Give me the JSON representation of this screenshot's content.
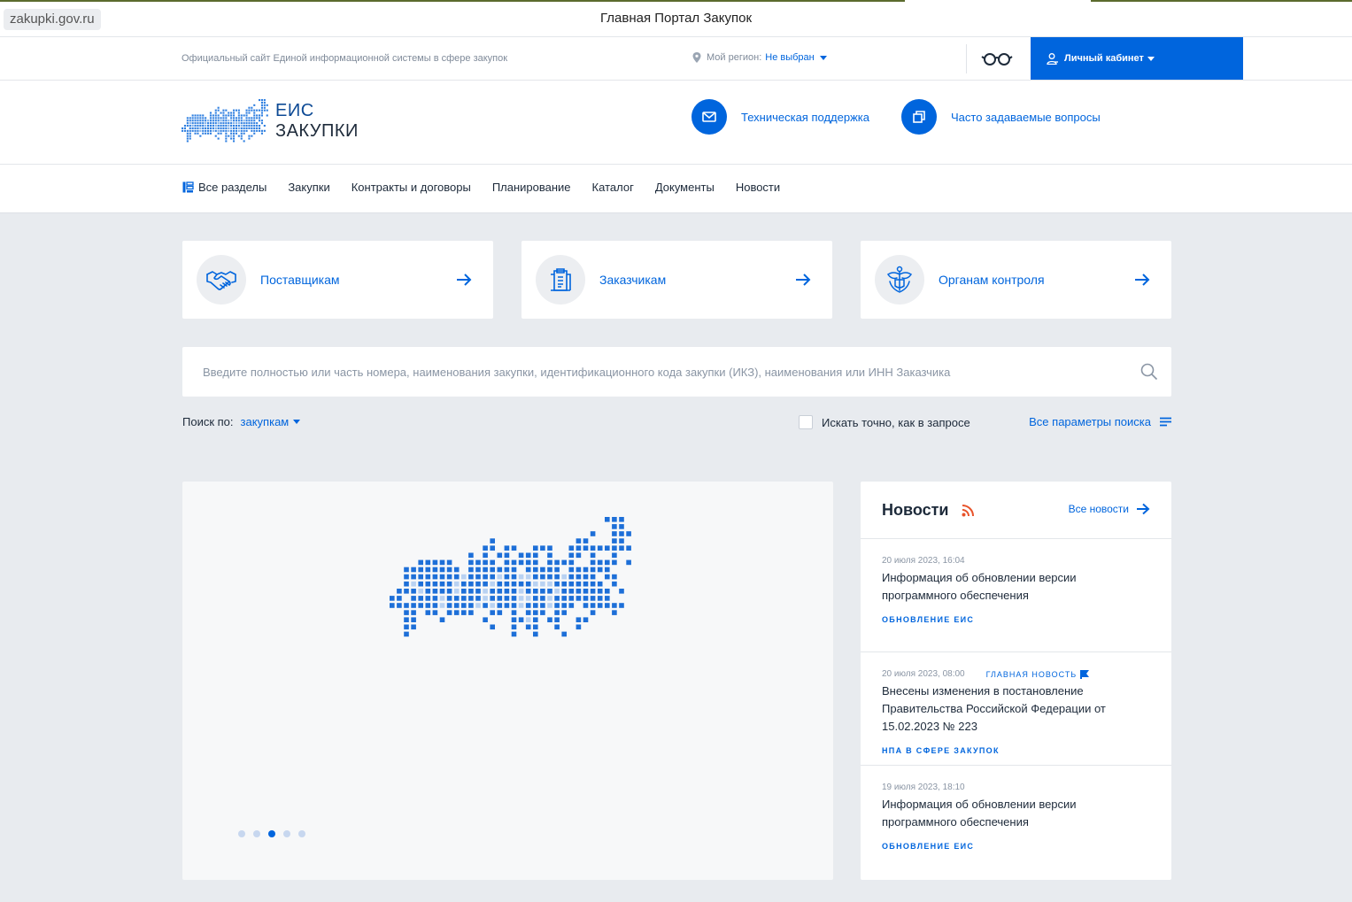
{
  "browser": {
    "url": "zakupki.gov.ru",
    "title": "Главная Портал Закупок"
  },
  "infobar": {
    "site_description": "Официальный сайт Единой информационной системы в сфере закупок",
    "region_label": "Мой регион:",
    "region_value": "Не выбран",
    "cabinet_label": "Личный кабинет"
  },
  "header": {
    "logo_line1": "ЕИС",
    "logo_line2": "ЗАКУПКИ",
    "support_label": "Техническая поддержка",
    "faq_label": "Часто задаваемые вопросы"
  },
  "nav": {
    "items": [
      "Все разделы",
      "Закупки",
      "Контракты и договоры",
      "Планирование",
      "Каталог",
      "Документы",
      "Новости"
    ]
  },
  "roles": [
    {
      "label": "Поставщикам",
      "icon": "handshake-icon"
    },
    {
      "label": "Заказчикам",
      "icon": "document-icon"
    },
    {
      "label": "Органам контроля",
      "icon": "emblem-icon"
    }
  ],
  "search": {
    "placeholder": "Введите полностью или часть номера, наименования закупки, идентификационного кода закупки (ИКЗ), наименования или ИНН Заказчика",
    "search_by_label": "Поиск по:",
    "search_by_value": "закупкам",
    "exact_label": "Искать точно, как в запросе",
    "exact_checked": false,
    "all_params_label": "Все параметры поиска"
  },
  "banner": {
    "slides": 5,
    "active_slide": 3
  },
  "news": {
    "title": "Новости",
    "all_label": "Все новости",
    "items": [
      {
        "date": "20 июля 2023, 16:04",
        "flag": "",
        "title": "Информация об обновлении версии программного обеспечения",
        "tag": "ОБНОВЛЕНИЕ ЕИС"
      },
      {
        "date": "20 июля 2023, 08:00",
        "flag": "ГЛАВНАЯ НОВОСТЬ",
        "title": "Внесены изменения в постановление Правительства Российской Федерации от 15.02.2023 № 223",
        "tag": "НПА В СФЕРЕ ЗАКУПОК"
      },
      {
        "date": "19 июля 2023, 18:10",
        "flag": "",
        "title": "Информация об обновлении версии программного обеспечения",
        "tag": "ОБНОВЛЕНИЕ ЕИС"
      }
    ]
  },
  "colors": {
    "accent": "#0065dd",
    "background": "#e8ebef",
    "rss": "#e8532a"
  }
}
